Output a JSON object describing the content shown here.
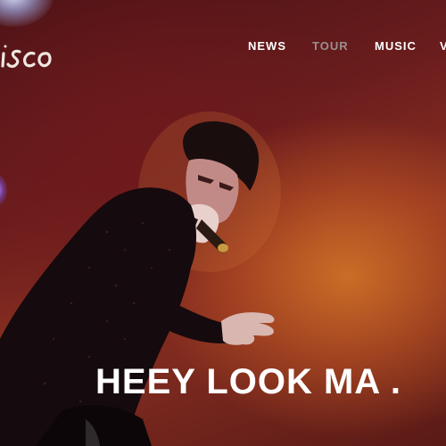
{
  "logo": {
    "text": "isco"
  },
  "nav": {
    "items": [
      {
        "label": "NEWS",
        "active": true
      },
      {
        "label": "TOUR",
        "active": false
      },
      {
        "label": "MUSIC",
        "active": true
      },
      {
        "label": "V",
        "active": true
      }
    ]
  },
  "hero": {
    "headline": "HEEY LOOK MA .",
    "image": "performer-singing-into-microphone"
  },
  "colors": {
    "nav_text": "#ffffff",
    "nav_text_dim": "#9a8f8f",
    "background_dark": "#4a1216",
    "background_glow": "#d67828"
  }
}
